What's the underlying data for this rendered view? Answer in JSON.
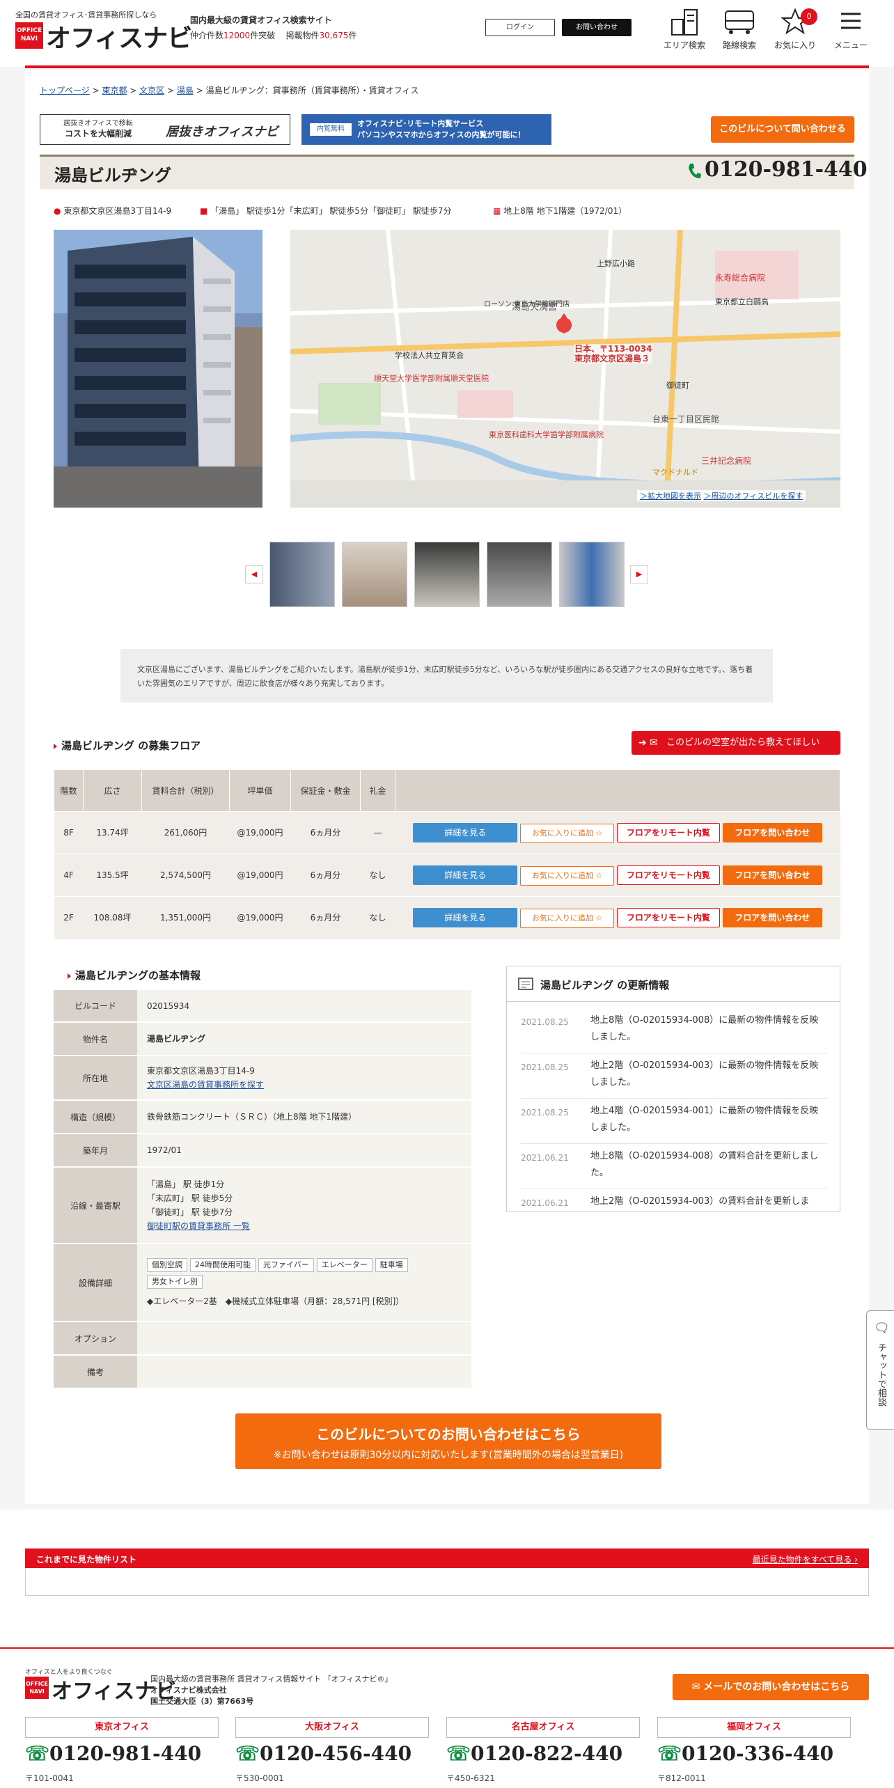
{
  "header": {
    "catch": "全国の賃貸オフィス･賃貸事務所探しなら",
    "logo_badge": "OFFICE NAVI",
    "logo_text": "オフィスナビ",
    "tagline": "国内最大級の賃貸オフィス検索サイト",
    "count_prefix": "仲介件数",
    "count_value": "12000",
    "count_suffix": "件突破",
    "listing_prefix": "掲載物件",
    "listing_value": "30,675",
    "listing_suffix": "件",
    "login": "ログイン",
    "contact": "お問い合わせ",
    "nav": [
      {
        "label": "エリア検索",
        "icon": "buildings-icon"
      },
      {
        "label": "路線検索",
        "icon": "train-icon"
      },
      {
        "label": "お気に入り",
        "icon": "star-icon"
      },
      {
        "label": "メニュー",
        "icon": "hamburger-icon"
      }
    ],
    "fav_count": "0"
  },
  "breadcrumb": [
    "トップページ",
    "東京都",
    "文京区",
    "湯島",
    "湯島ビルヂング：貸事務所（賃貸事務所）・賃貸オフィス"
  ],
  "banners": {
    "b1_small": "居抜きオフィスで移転",
    "b1_main": "コストを大幅削減",
    "b1_logo": "居抜きオフィスナビ",
    "b2_badge": "内覧無料",
    "b2_line1": "オフィスナビ･リモート内覧サービス",
    "b2_line2": "パソコンやスマホからオフィスの内覧が可能に！",
    "inquiry": "このビルについて問い合わせる"
  },
  "building": {
    "name": "湯島ビルヂング",
    "phone": "0120-981-440",
    "address": "東京都文京区湯島3丁目14-9",
    "access": "「湯島」 駅徒歩1分「末広町」 駅徒歩5分「御徒町」 駅徒歩7分",
    "floors_info": "地上8階 地下1階建（1972/01）",
    "description": "文京区湯島にございます、湯島ビルヂングをご紹介いたします。湯島駅が徒歩1分、末広町駅徒歩5分など、いろいろな駅が徒歩圏内にある交通アクセスの良好な立地です。、落ち着いた雰囲気のエリアですが、周辺に飲食店が様々あり充実しております。"
  },
  "map": {
    "pin_line1": "日本、〒113-0034",
    "pin_line2": "東京都文京区湯島３",
    "link_expand": "＞拡大地図を表示",
    "link_nearby": "＞周辺のオフィスビルを探す",
    "labels": [
      "ローソン 東京大学龍岡門店",
      "湯島天満宮",
      "東京医科歯科大学歯学部附属病院",
      "順天堂大学医学部附属順天堂医院",
      "永寿総合病院",
      "台東一丁目区民館",
      "三井記念病院",
      "マクドナルド",
      "上野広小路",
      "御徒町",
      "学校法人共立育英会",
      "東京都立白鷗高"
    ]
  },
  "floors_section": {
    "title": "湯島ビルヂング の募集フロア",
    "notify": "このビルの空室が出たら教えてほしい",
    "headers": [
      "階数",
      "広さ",
      "賃料合計（税別）",
      "坪単価",
      "保証金・敷金",
      "礼金"
    ],
    "rows": [
      {
        "floor": "8F",
        "area": "13.74坪",
        "rent": "261,060円",
        "unit": "@19,000円",
        "deposit": "6ヵ月分",
        "key": "—"
      },
      {
        "floor": "4F",
        "area": "135.5坪",
        "rent": "2,574,500円",
        "unit": "@19,000円",
        "deposit": "6ヵ月分",
        "key": "なし"
      },
      {
        "floor": "2F",
        "area": "108.08坪",
        "rent": "1,351,000円",
        "unit": "@19,000円",
        "deposit": "6ヵ月分",
        "key": "なし"
      }
    ],
    "btn_detail": "詳細を見る",
    "btn_fav": "お気に入りに追加",
    "btn_remote": "フロアをリモート内覧",
    "btn_inquire": "フロアを問い合わせ"
  },
  "basic": {
    "title": "湯島ビルヂングの基本情報",
    "code_label": "ビルコード",
    "code": "02015934",
    "name_label": "物件名",
    "name": "湯島ビルヂング",
    "addr_label": "所在地",
    "addr": "東京都文京区湯島3丁目14-9",
    "addr_link": "文京区湯島の賃貸事務所を探す",
    "struct_label": "構造（規模）",
    "struct": "鉄骨鉄筋コンクリート（ＳＲＣ）（地上8階 地下1階建）",
    "built_label": "築年月",
    "built": "1972/01",
    "station_label": "沿線・最寄駅",
    "stations": [
      "「湯島」 駅 徒歩1分",
      "「末広町」 駅 徒歩5分",
      "「御徒町」 駅 徒歩7分"
    ],
    "station_link": "御徒町駅の賃貸事務所 一覧",
    "equip_label": "設備詳細",
    "equip_tags": [
      "個別空調",
      "24時間使用可能",
      "光ファイバー",
      "エレベーター",
      "駐車場",
      "男女トイレ別"
    ],
    "equip_note": "◆エレベーター2基　◆機械式立体駐車場（月額：28,571円 [税別]）",
    "option_label": "オプション",
    "note_label": "備考"
  },
  "updates": {
    "title": "湯島ビルヂング の更新情報",
    "items": [
      {
        "date": "2021.08.25",
        "text": "地上8階（O-02015934-008）に最新の物件情報を反映しました。"
      },
      {
        "date": "2021.08.25",
        "text": "地上2階（O-02015934-003）に最新の物件情報を反映しました。"
      },
      {
        "date": "2021.08.25",
        "text": "地上4階（O-02015934-001）に最新の物件情報を反映しました。"
      },
      {
        "date": "2021.06.21",
        "text": "地上8階（O-02015934-008）の賃料合計を更新しました。"
      },
      {
        "date": "2021.06.21",
        "text": "地上2階（O-02015934-003）の賃料合計を更新しま"
      }
    ]
  },
  "cta": {
    "main": "このビルについてのお問い合わせはこちら",
    "sub": "※お問い合わせは原則30分以内に対応いたします(営業時間外の場合は翌営業日)"
  },
  "chat": "チャットで相談",
  "history": {
    "title": "これまでに見た物件リスト",
    "link": "最近見た物件をすべて見る"
  },
  "footer": {
    "logo_catch": "オフィスと人をより良くつなぐ",
    "desc": "国内最大級の賃貸事務所 賃貸オフィス情報サイト 「オフィスナビ®」",
    "company": "オフィスナビ株式会社",
    "license": "国土交通大臣（3）第7663号",
    "mail_btn": "メールでのお問い合わせはこちら",
    "offices": [
      {
        "name": "東京オフィス",
        "phone": "0120-981-440",
        "zip": "〒101-0041"
      },
      {
        "name": "大阪オフィス",
        "phone": "0120-456-440",
        "zip": "〒530-0001"
      },
      {
        "name": "名古屋オフィス",
        "phone": "0120-822-440",
        "zip": "〒450-6321"
      },
      {
        "name": "福岡オフィス",
        "phone": "0120-336-440",
        "zip": "〒812-0011"
      }
    ]
  },
  "colors": {
    "brand_red": "#e0111d",
    "accent_orange": "#f26b0f",
    "blue": "#3d8fd0"
  }
}
